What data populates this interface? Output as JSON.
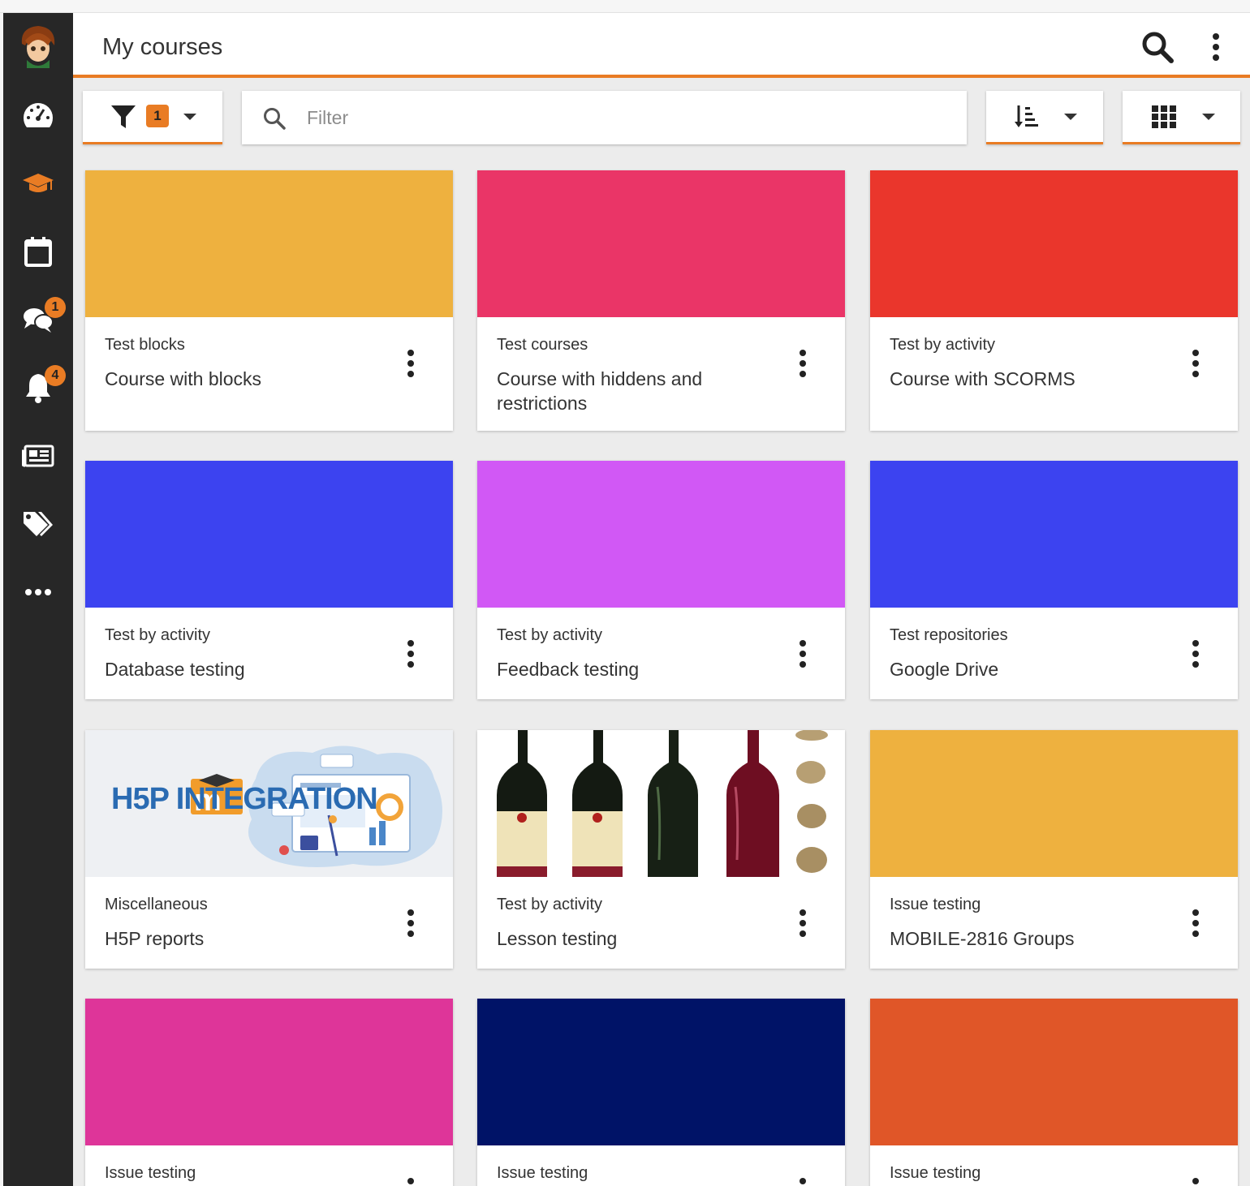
{
  "header": {
    "title": "My courses"
  },
  "sidebar": {
    "messages_badge": "1",
    "notifications_badge": "4"
  },
  "toolbar": {
    "filter_count": "1",
    "search_placeholder": "Filter"
  },
  "courses": [
    {
      "category": "Test blocks",
      "name": "Course with blocks",
      "color": "#eeb13f"
    },
    {
      "category": "Test courses",
      "name": "Course with hiddens and restrictions",
      "color": "#ea3567"
    },
    {
      "category": "Test by activity",
      "name": "Course with SCORMS",
      "color": "#ea362c"
    },
    {
      "category": "Test by activity",
      "name": "Database testing",
      "color": "#3c43f0"
    },
    {
      "category": "Test by activity",
      "name": "Feedback testing",
      "color": "#d158f5"
    },
    {
      "category": "Test repositories",
      "name": "Google Drive",
      "color": "#3c43f0"
    },
    {
      "category": "Miscellaneous",
      "name": "H5P reports",
      "image_text": "H5P INTEGRATION"
    },
    {
      "category": "Test by activity",
      "name": "Lesson testing"
    },
    {
      "category": "Issue testing",
      "name": "MOBILE-2816 Groups",
      "color": "#eeb13f"
    },
    {
      "category": "Issue testing",
      "name": "",
      "color": "#de3599"
    },
    {
      "category": "Issue testing",
      "name": "",
      "color": "#001367"
    },
    {
      "category": "Issue testing",
      "name": "",
      "color": "#e05628"
    }
  ]
}
